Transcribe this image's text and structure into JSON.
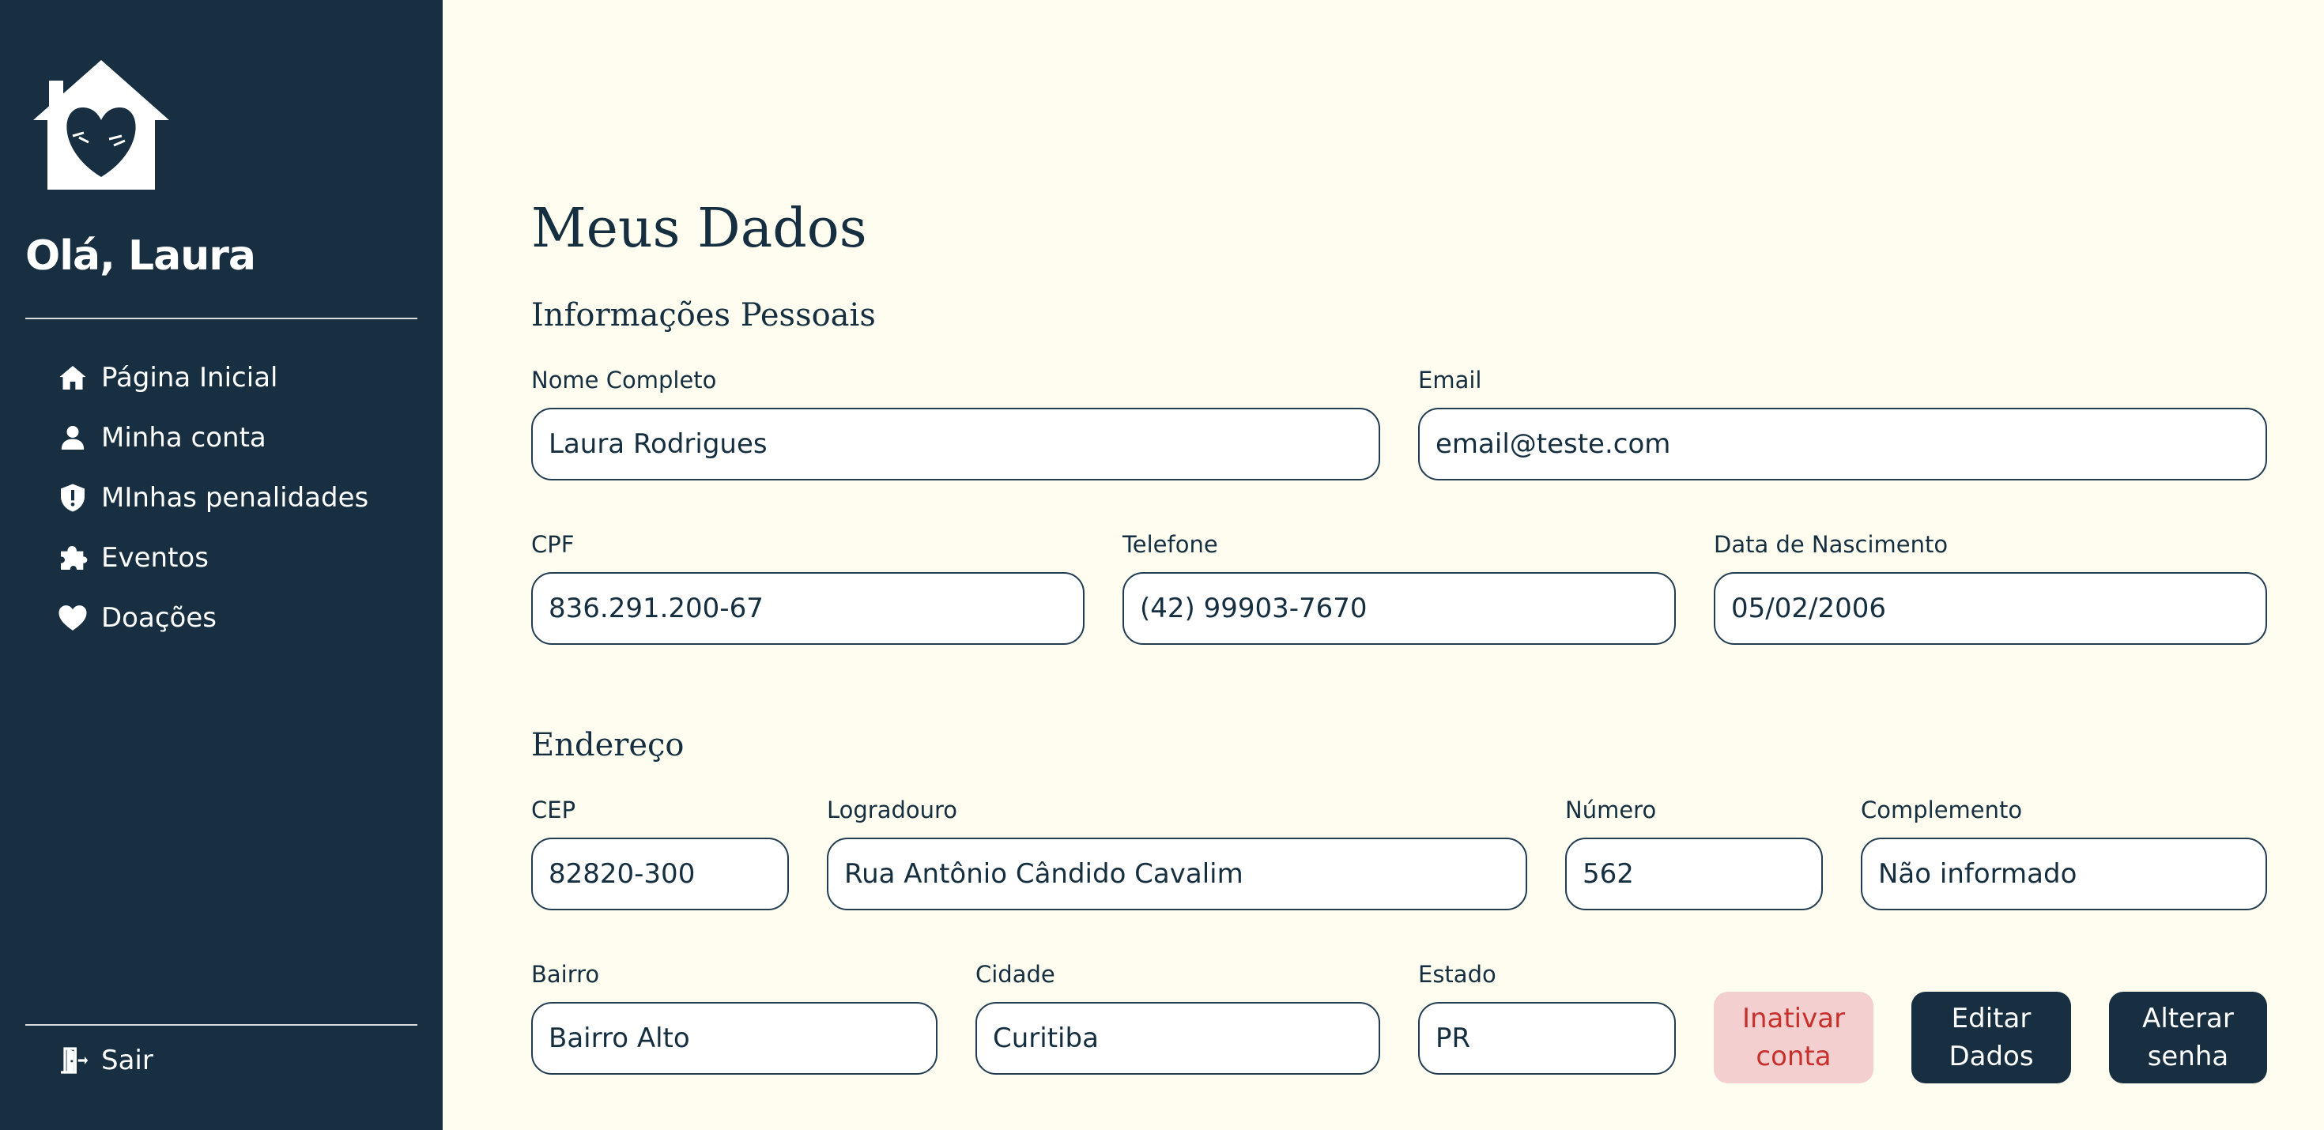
{
  "sidebar": {
    "logo_icon": "house-heart-logo",
    "greeting": "Olá, Laura",
    "nav_items": [
      {
        "label": "Página Inicial",
        "icon": "home-icon"
      },
      {
        "label": "Minha conta",
        "icon": "user-icon"
      },
      {
        "label": "MInhas penalidades",
        "icon": "shield-alert-icon"
      },
      {
        "label": "Eventos",
        "icon": "puzzle-icon"
      },
      {
        "label": "Doações",
        "icon": "heart-icon"
      }
    ],
    "logout": {
      "label": "Sair",
      "icon": "door-exit-icon"
    }
  },
  "main": {
    "title": "Meus Dados",
    "personal": {
      "heading": "Informações Pessoais",
      "full_name": {
        "label": "Nome Completo",
        "value": "Laura Rodrigues"
      },
      "email": {
        "label": "Email",
        "value": "email@teste.com"
      },
      "cpf": {
        "label": "CPF",
        "value": "836.291.200-67"
      },
      "phone": {
        "label": "Telefone",
        "value": "(42) 99903-7670"
      },
      "birth_date": {
        "label": "Data de Nascimento",
        "value": "05/02/2006"
      }
    },
    "address": {
      "heading": "Endereço",
      "cep": {
        "label": "CEP",
        "value": "82820-300"
      },
      "street": {
        "label": "Logradouro",
        "value": "Rua Antônio Cândido Cavalim"
      },
      "number": {
        "label": "Número",
        "value": "562"
      },
      "complement": {
        "label": "Complemento",
        "value": "Não informado"
      },
      "district": {
        "label": "Bairro",
        "value": "Bairro Alto"
      },
      "city": {
        "label": "Cidade",
        "value": "Curitiba"
      },
      "state": {
        "label": "Estado",
        "value": "PR"
      }
    },
    "actions": {
      "deactivate": "Inativar conta",
      "edit": "Editar Dados",
      "change_password": "Alterar senha"
    }
  },
  "colors": {
    "sidebar_bg": "#172f40",
    "page_bg": "#fefdf0",
    "danger_bg": "#f4cfcf",
    "danger_text": "#c8302c"
  }
}
